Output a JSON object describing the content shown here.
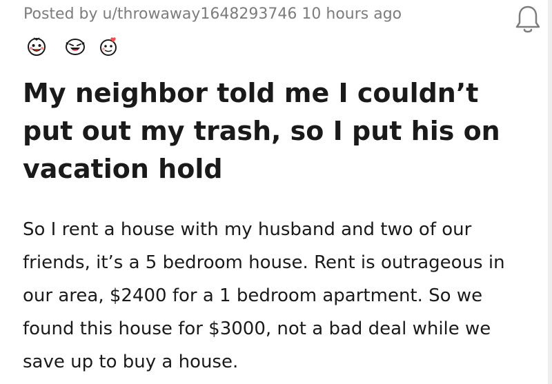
{
  "post": {
    "posted_by_prefix": "Posted by",
    "author": "u/throwaway1648293746",
    "time": "10 hours ago",
    "title": "My neighbor told me I couldn’t put out my trash, so I put his on vacation hold",
    "body": "So I rent a house with my husband and two of our friends, it’s a 5 bedroom house. Rent is outrageous in our area, $2400 for a 1 bedroom apartment. So we found this house for $3000, not a bad deal while we save up to buy a house."
  },
  "awards": [
    {
      "name": "wholesome-award-icon"
    },
    {
      "name": "laughing-face-award-icon"
    },
    {
      "name": "heartwarming-award-icon"
    }
  ],
  "icons": {
    "notification": "bell-icon"
  }
}
